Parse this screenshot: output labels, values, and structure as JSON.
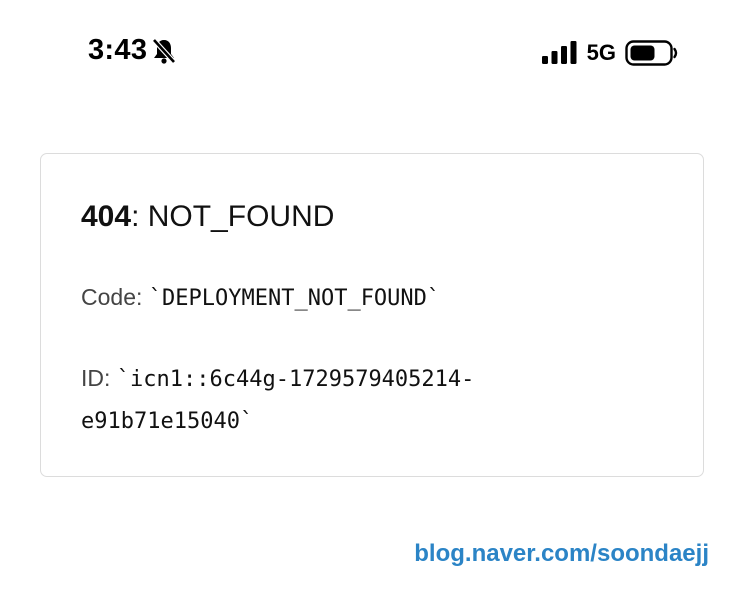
{
  "status_bar": {
    "time": "3:43",
    "network": "5G",
    "icons": [
      "bell-slash-icon",
      "signal-bars-icon",
      "battery-icon"
    ]
  },
  "error": {
    "status_code": "404",
    "separator": ": ",
    "status_text": "NOT_FOUND",
    "code_label": "Code: ",
    "code_value": "`DEPLOYMENT_NOT_FOUND`",
    "id_label": "ID: ",
    "id_value": "`icn1::6c44g-1729579405214-e91b71e15040`"
  },
  "watermark": "blog.naver.com/soondaejj",
  "colors": {
    "card_border": "#dcdcdc",
    "watermark": "#2b84c6",
    "text": "#111111",
    "label": "#444444"
  }
}
